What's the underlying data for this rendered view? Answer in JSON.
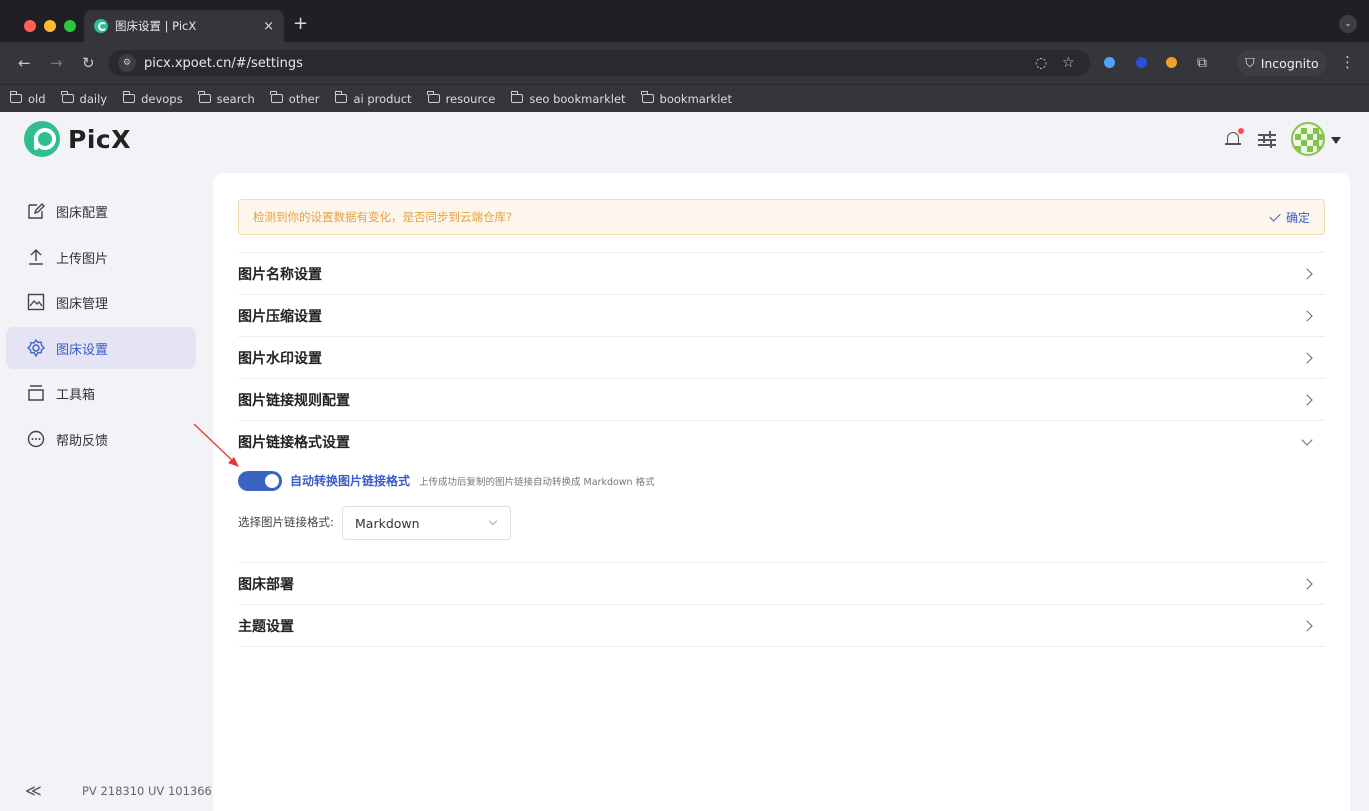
{
  "browser": {
    "tab_title": "图床设置 | PicX",
    "tab_close": "×",
    "new_tab": "+",
    "url": "picx.xpoet.cn/#/settings",
    "incognito_label": "Incognito",
    "bookmarks": [
      "old",
      "daily",
      "devops",
      "search",
      "other",
      "ai product",
      "resource",
      "seo bookmarklet",
      "bookmarklet"
    ],
    "colors": {
      "ext1": "#4fa3ff",
      "ext2": "#2b4fd6",
      "ext3": "#f0a02c"
    }
  },
  "app": {
    "logo_text": "PicX",
    "icons": {
      "bell": "bell-icon",
      "settings": "sliders-icon",
      "avatar": "avatar"
    }
  },
  "sidebar": {
    "items": [
      {
        "label": "图床配置",
        "icon": "edit-icon"
      },
      {
        "label": "上传图片",
        "icon": "upload-icon"
      },
      {
        "label": "图床管理",
        "icon": "image-icon"
      },
      {
        "label": "图床设置",
        "icon": "gear-icon",
        "active": true
      },
      {
        "label": "工具箱",
        "icon": "toolbox-icon"
      },
      {
        "label": "帮助反馈",
        "icon": "chat-icon"
      }
    ],
    "collapse": "≪",
    "stats": "PV 218310 UV 101366"
  },
  "main": {
    "alert": {
      "message": "检测到你的设置数据有变化，是否同步到云端仓库?",
      "confirm": "确定"
    },
    "sections": [
      {
        "label": "图片名称设置",
        "expanded": false
      },
      {
        "label": "图片压缩设置",
        "expanded": false
      },
      {
        "label": "图片水印设置",
        "expanded": false
      },
      {
        "label": "图片链接规则配置",
        "expanded": false
      },
      {
        "label": "图片链接格式设置",
        "expanded": true
      },
      {
        "label": "图床部署",
        "expanded": false
      },
      {
        "label": "主题设置",
        "expanded": false
      }
    ],
    "link_format": {
      "toggle_on": true,
      "toggle_label": "自动转换图片链接格式",
      "toggle_desc": "上传成功后复制的图片链接自动转换成 Markdown 格式",
      "select_label": "选择图片链接格式:",
      "select_value": "Markdown"
    },
    "accent_color": "#3a63c4"
  }
}
